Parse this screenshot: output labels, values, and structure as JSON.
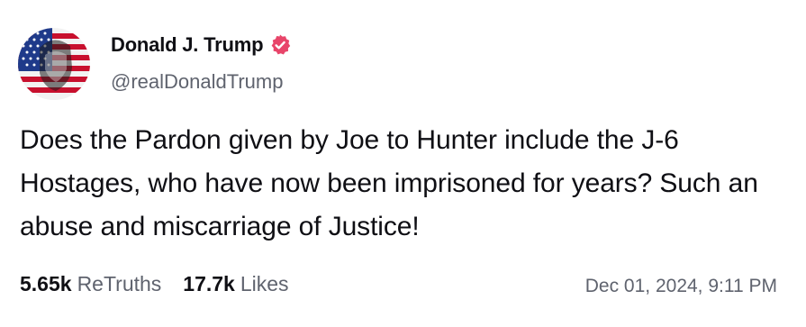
{
  "author": {
    "display_name": "Donald J. Trump",
    "handle": "@realDonaldTrump",
    "avatar_icon": "avatar-flag-portrait",
    "verified_icon": "verified-badge-icon",
    "verified_color": "#e8456a"
  },
  "post": {
    "text": "Does the Pardon given by Joe to Hunter include the J-6 Hostages, who have now been imprisoned for years? Such an abuse and miscarriage of Justice!"
  },
  "stats": {
    "retruths_count": "5.65k",
    "retruths_label": "ReTruths",
    "likes_count": "17.7k",
    "likes_label": "Likes"
  },
  "timestamp": "Dec 01, 2024, 9:11 PM"
}
